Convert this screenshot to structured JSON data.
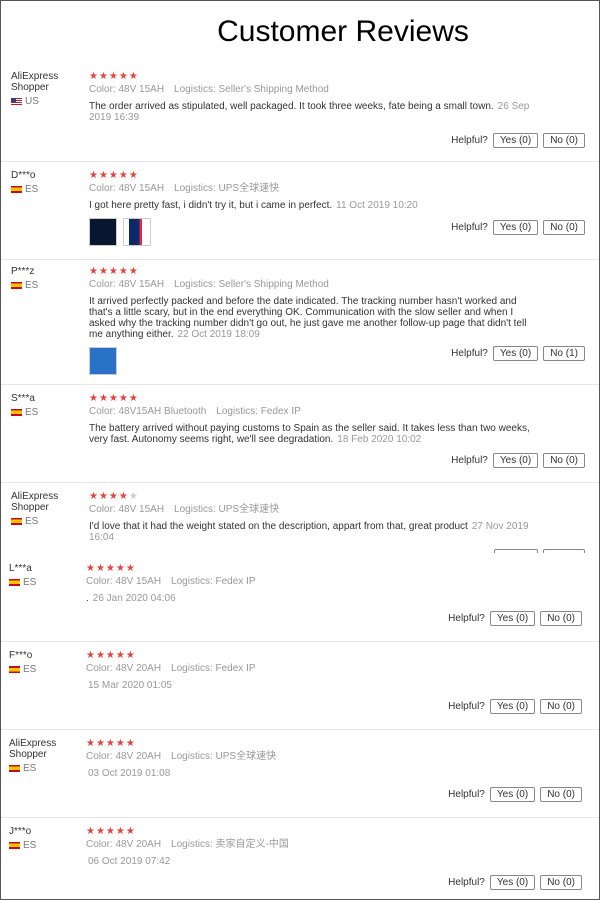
{
  "page_title": "Customer Reviews",
  "helpful_label": "Helpful?",
  "reviews": [
    {
      "user": "AliExpress Shopper",
      "country": "US",
      "stars": 5,
      "color": "Color: 48V 15AH",
      "logistics": "Logistics: Seller's Shipping Method",
      "text": "The order arrived as stipulated, well packaged. It took three weeks, fate being a small town.",
      "date": "26 Sep 2019 16:39",
      "yes": "Yes (0)",
      "no": "No (0)"
    },
    {
      "user": "D***o",
      "country": "ES",
      "stars": 5,
      "color": "Color: 48V 15AH",
      "logistics": "Logistics: UPS全球速快",
      "text": "I got here pretty fast, i didn't try it, but i came in perfect.",
      "date": "11 Oct 2019 10:20",
      "yes": "Yes (0)",
      "no": "No (0)"
    },
    {
      "user": "P***z",
      "country": "ES",
      "stars": 5,
      "color": "Color: 48V 15AH",
      "logistics": "Logistics: Seller's Shipping Method",
      "text": "It arrived perfectly packed and before the date indicated. The tracking number hasn't worked and that's a little scary, but in the end everything OK. Communication with the slow seller and when I asked why the tracking number didn't go out, he just gave me another follow-up page that didn't tell me anything either.",
      "date": "22 Oct 2019 18:09",
      "yes": "Yes (0)",
      "no": "No (1)"
    },
    {
      "user": "S***a",
      "country": "ES",
      "stars": 5,
      "color": "Color: 48V15AH Bluetooth",
      "logistics": "Logistics: Fedex IP",
      "text": "The battery arrived without paying customs to Spain as the seller said. It takes less than two weeks, very fast. Autonomy seems right, we'll see degradation.",
      "date": "18 Feb 2020 10:02",
      "yes": "Yes (0)",
      "no": "No (0)"
    },
    {
      "user": "AliExpress Shopper",
      "country": "ES",
      "stars": 4,
      "color": "Color: 48V 15AH",
      "logistics": "Logistics: UPS全球速快",
      "text": "I'd love that it had the weight stated on the description, appart from that, great product",
      "date": "27 Nov 2019 16:04",
      "yes": "",
      "no": ""
    },
    {
      "user": "L***a",
      "country": "ES",
      "stars": 5,
      "color": "Color: 48V 15AH",
      "logistics": "Logistics: Fedex IP",
      "text": ".",
      "date": "26 Jan 2020 04:06",
      "yes": "Yes (0)",
      "no": "No (0)"
    },
    {
      "user": "F***o",
      "country": "ES",
      "stars": 5,
      "color": "Color: 48V 20AH",
      "logistics": "Logistics: Fedex IP",
      "text": "",
      "date": "15 Mar 2020 01:05",
      "yes": "Yes (0)",
      "no": "No (0)"
    },
    {
      "user": "AliExpress Shopper",
      "country": "ES",
      "stars": 5,
      "color": "Color: 48V 20AH",
      "logistics": "Logistics: UPS全球速快",
      "text": "",
      "date": "03 Oct 2019 01:08",
      "yes": "Yes (0)",
      "no": "No (0)"
    },
    {
      "user": "J***o",
      "country": "ES",
      "stars": 5,
      "color": "Color: 48V 20AH",
      "logistics": "Logistics: 卖家自定义-中国",
      "text": "",
      "date": "06 Oct 2019 07:42",
      "yes": "Yes (0)",
      "no": "No (0)"
    }
  ]
}
